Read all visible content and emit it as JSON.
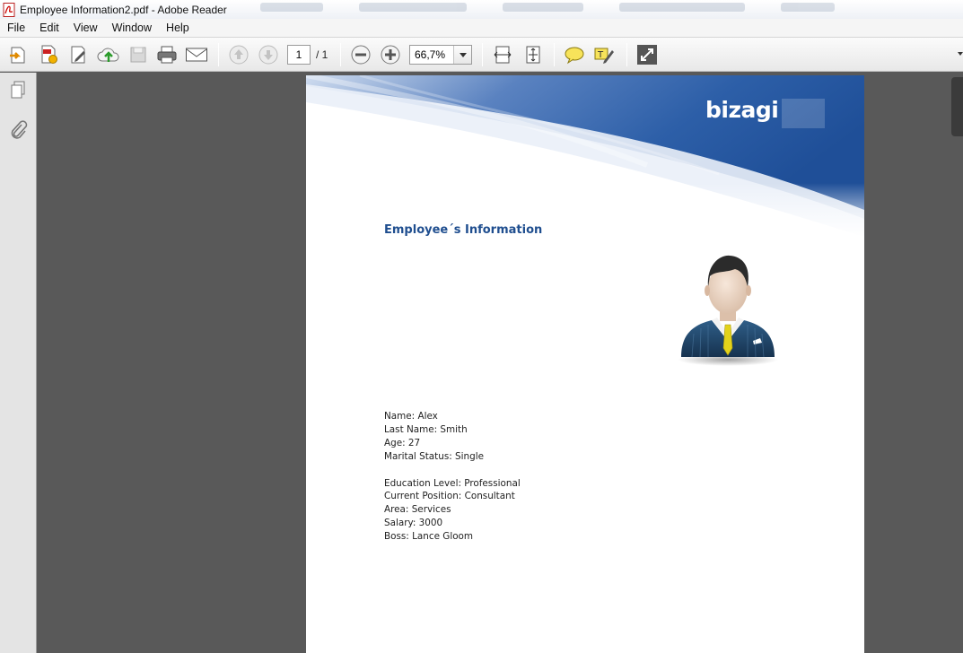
{
  "window": {
    "title": "Employee Information2.pdf - Adobe Reader"
  },
  "menu": [
    "File",
    "Edit",
    "View",
    "Window",
    "Help"
  ],
  "toolbar": {
    "page_current": "1",
    "page_total": "/ 1",
    "zoom": "66,7%"
  },
  "document": {
    "logo": "bizagi",
    "heading": "Employee´s Information",
    "fields": [
      "Name: Alex",
      "Last Name: Smith",
      "Age: 27",
      "Marital Status: Single",
      "Education Level: Professional",
      "Current Position: Consultant",
      "Area: Services",
      "Salary: 3000",
      "Boss: Lance Gloom"
    ]
  },
  "icons": {
    "toolbar": [
      "open-file-icon",
      "create-pdf-icon",
      "edit-icon",
      "upload-cloud-icon",
      "save-icon",
      "print-icon",
      "email-icon",
      "previous-page-icon",
      "next-page-icon",
      "zoom-out-icon",
      "zoom-in-icon",
      "fit-width-icon",
      "fit-page-icon",
      "comment-icon",
      "highlight-icon",
      "fullscreen-icon"
    ],
    "sidebar": [
      "pages-icon",
      "attachments-icon"
    ]
  },
  "colors": {
    "heading": "#1f4e8f",
    "banner": "#2d5fa8",
    "workspace": "#595959"
  }
}
